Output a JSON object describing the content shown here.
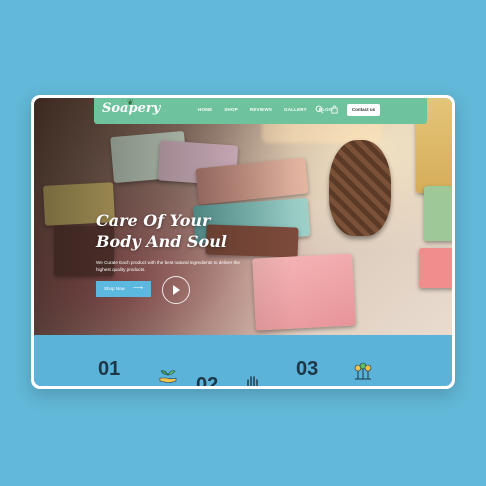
{
  "brand": {
    "logo_text": "Soapery"
  },
  "nav": {
    "items": [
      {
        "label": "HOME"
      },
      {
        "label": "SHOP"
      },
      {
        "label": "REVIEWS"
      },
      {
        "label": "GALLERY"
      },
      {
        "label": "BLOG"
      }
    ],
    "contact_label": "Contact us"
  },
  "hero": {
    "title_line1": "Care Of Your",
    "title_line2": "Body And Soul",
    "text": "We Curate Each product with the best natural ingredients to deliver the highest quality products.",
    "shop_label": "Shop Now",
    "shop_arrow": "⟶"
  },
  "features": {
    "items": [
      {
        "number": "01",
        "icon": "hand-plant-icon"
      },
      {
        "number": "02",
        "icon": "hand-wave-icon"
      },
      {
        "number": "03",
        "icon": "plants-icon"
      }
    ]
  },
  "colors": {
    "page_bg": "#62b8d8",
    "header_bg": "#6ec39c",
    "button_bg": "#5bb8df",
    "feature_bg": "#5bb3d9",
    "number_color": "#1d3748"
  }
}
